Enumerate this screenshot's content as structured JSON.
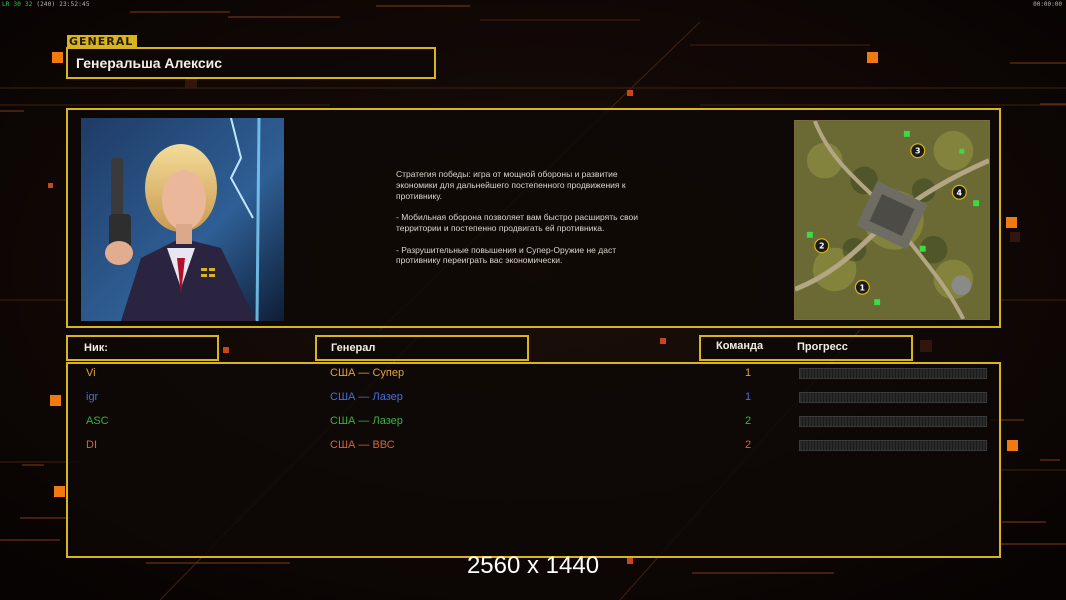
{
  "hud": {
    "left_prefix": "LR",
    "left_fps": "30 32",
    "left_extra": "(240)",
    "left_time": "23:52:45",
    "right_time": "00:00:00"
  },
  "general_tag": "GENERAL",
  "general_name": "Генеральша Алексис",
  "description": "Стратегия победы: игра от мощной обороны и развитие\n экономики для дальнейшего постепенного продвижения к\n противнику.\n\n- Мобильная оборона позволяет вам быстро расширять свои\n территории и постепенно продвигать ей противника.\n\n- Разрушительные повышения и Супер-Оружие не даст\n противнику переиграть вас экономически.",
  "headers": {
    "nick": "Ник:",
    "general": "Генерал",
    "team": "Команда",
    "progress": "Прогресс"
  },
  "players": [
    {
      "nick": "Vi",
      "general": "США — Супер",
      "team": "1",
      "progress": 0,
      "color": "#e0a23a"
    },
    {
      "nick": "igr",
      "general": "США — Лазер",
      "team": "1",
      "progress": 0,
      "color": "#4b6bdc"
    },
    {
      "nick": "ASC",
      "general": "США — Лазер",
      "team": "2",
      "progress": 0,
      "color": "#39b43a"
    },
    {
      "nick": "DI",
      "general": "США — ВВС",
      "team": "2",
      "progress": 0,
      "color": "#d0673a"
    }
  ],
  "minimap": {
    "start_positions": [
      "1",
      "2",
      "3",
      "4"
    ]
  },
  "resolution_label": "2560 x 1440",
  "colors": {
    "accent": "#d8b41d",
    "orange": "#f07a10",
    "background": "#0b0605"
  }
}
